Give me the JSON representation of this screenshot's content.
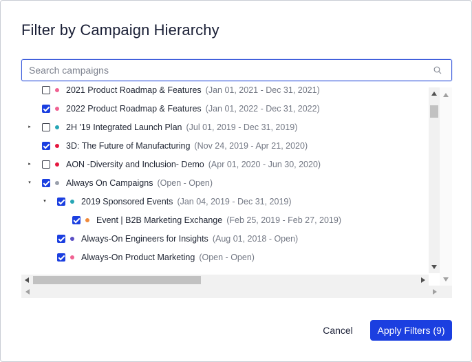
{
  "dialog": {
    "title": "Filter by Campaign Hierarchy",
    "search": {
      "placeholder": "Search campaigns",
      "value": ""
    },
    "buttons": {
      "cancel": "Cancel",
      "apply": "Apply Filters (9)"
    }
  },
  "colors": {
    "accent": "#1b3fe0",
    "dot_pink": "#f06292",
    "dot_teal": "#26a6b5",
    "dot_red": "#e5173f",
    "dot_gray": "#9aa0ac",
    "dot_orange": "#f08a3c",
    "dot_purple": "#5b4fc4"
  },
  "tree": [
    {
      "name": "2021 Product Roadmap & Features",
      "dates": "(Jan 01, 2021 - Dec 31, 2021)",
      "checked": false,
      "caret": "",
      "dot": "#f06292",
      "level": 0
    },
    {
      "name": "2022 Product Roadmap & Features",
      "dates": "(Jan 01, 2022 - Dec 31, 2022)",
      "checked": true,
      "caret": "",
      "dot": "#f06292",
      "level": 0
    },
    {
      "name": "2H '19 Integrated Launch Plan",
      "dates": "(Jul 01, 2019 - Dec 31, 2019)",
      "checked": false,
      "caret": "right",
      "dot": "#26a6b5",
      "level": 0
    },
    {
      "name": "3D: The Future of Manufacturing",
      "dates": "(Nov 24, 2019 - Apr 21, 2020)",
      "checked": true,
      "caret": "",
      "dot": "#e5173f",
      "level": 0
    },
    {
      "name": "AON -Diversity and Inclusion- Demo",
      "dates": "(Apr 01, 2020 - Jun 30, 2020)",
      "checked": false,
      "caret": "right",
      "dot": "#e5173f",
      "level": 0
    },
    {
      "name": "Always On Campaigns",
      "dates": "(Open - Open)",
      "checked": true,
      "caret": "down",
      "dot": "#9aa0ac",
      "level": 0
    },
    {
      "name": "2019 Sponsored Events",
      "dates": "(Jan 04, 2019 - Dec 31, 2019)",
      "checked": true,
      "caret": "down",
      "dot": "#26a6b5",
      "level": 1
    },
    {
      "name": "Event | B2B Marketing Exchange",
      "dates": "(Feb 25, 2019 - Feb 27, 2019)",
      "checked": true,
      "caret": "",
      "dot": "#f08a3c",
      "level": 2
    },
    {
      "name": "Always-On Engineers for Insights",
      "dates": "(Aug 01, 2018 - Open)",
      "checked": true,
      "caret": "",
      "dot": "#5b4fc4",
      "level": 1
    },
    {
      "name": "Always-On Product Marketing",
      "dates": "(Open - Open)",
      "checked": true,
      "caret": "",
      "dot": "#f06292",
      "level": 1
    }
  ]
}
